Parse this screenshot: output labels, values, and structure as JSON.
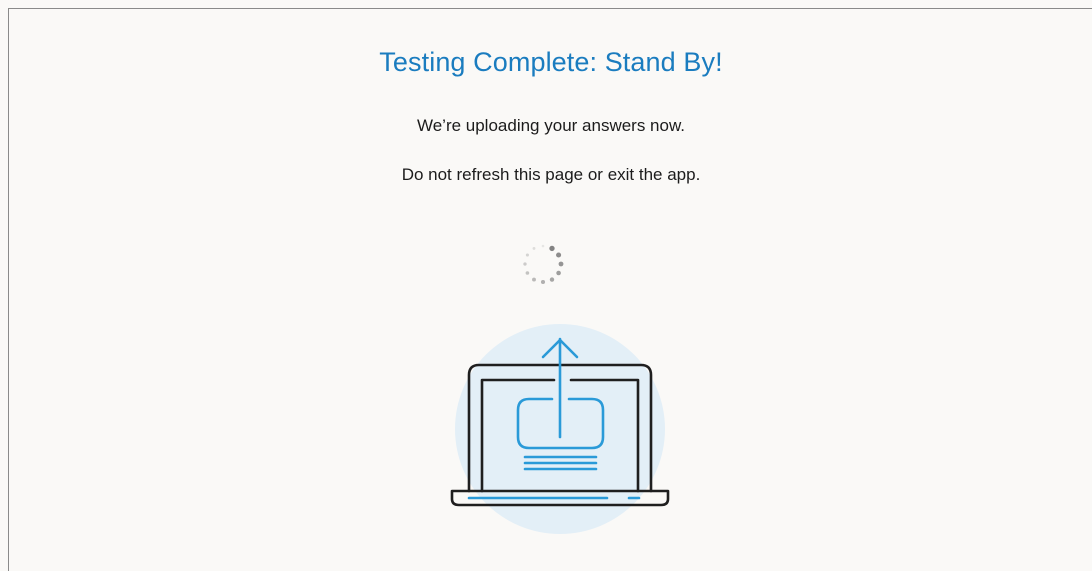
{
  "status": {
    "title": "Testing Complete: Stand By!",
    "message": "We’re uploading your answers now.",
    "warning": "Do not refresh this page or exit the app."
  },
  "spinner": {
    "icon": "loading-spinner-icon"
  },
  "illustration": {
    "icon": "laptop-upload-icon"
  },
  "colors": {
    "accent": "#1a7cbf",
    "illustration_blue": "#2a9ad8",
    "illustration_bg": "#e3eff7",
    "text": "#1c1c1c",
    "background": "#faf9f7"
  }
}
